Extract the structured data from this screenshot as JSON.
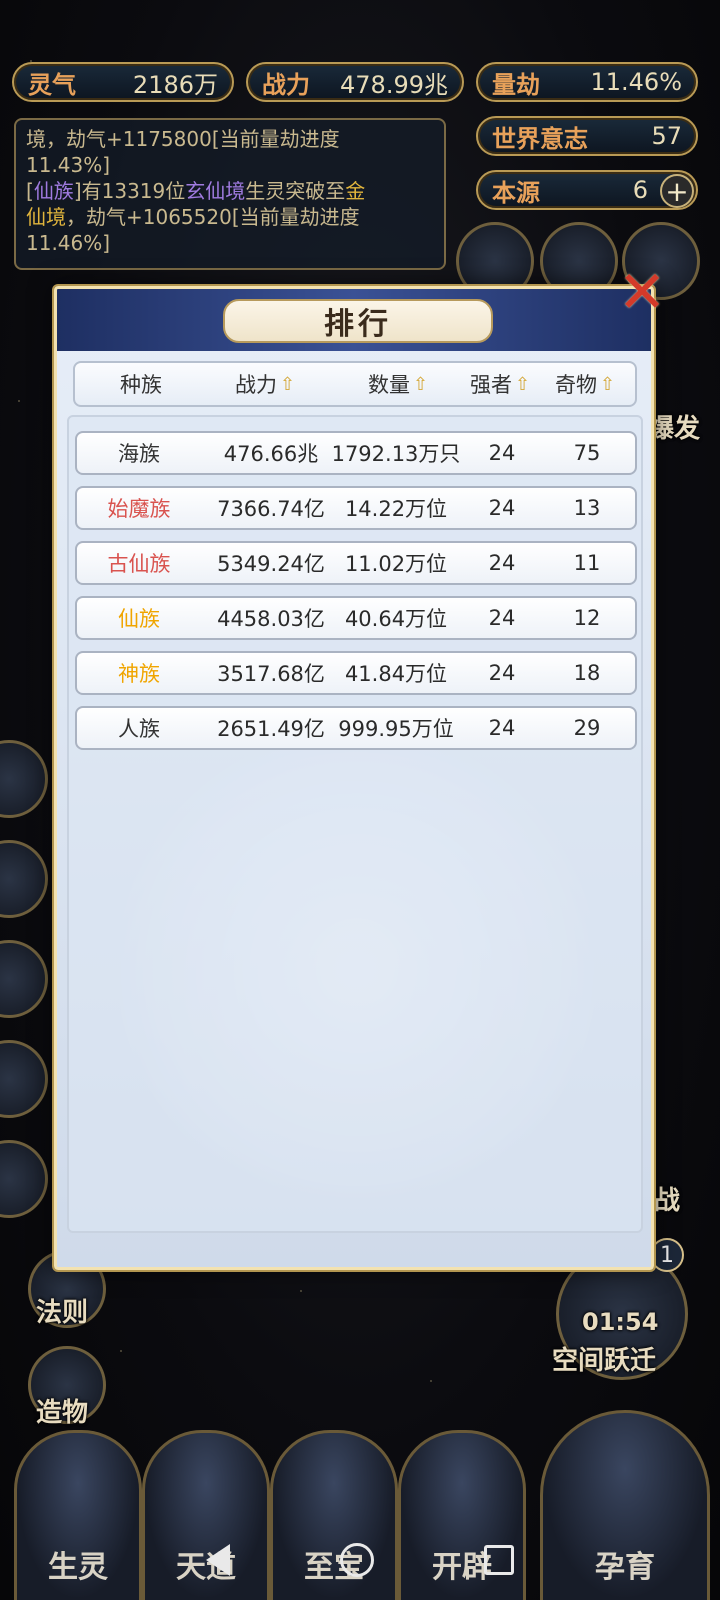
{
  "stats": {
    "lingqi": {
      "label": "灵气",
      "value": "2186万"
    },
    "zhanli": {
      "label": "战力",
      "value": "478.99兆"
    },
    "liangjie": {
      "label": "量劫",
      "value": "11.46%"
    },
    "world_will": {
      "label": "世界意志",
      "value": "57"
    },
    "origin": {
      "label": "本源",
      "value": "6"
    }
  },
  "log": {
    "line1": "境，劫气+1175800[当前量劫进度",
    "line2": "11.43%]",
    "line3_a": "[",
    "line3_race": "仙族",
    "line3_b": "]有13319位",
    "line3_realm": "玄仙境",
    "line3_c": "生灵突破至",
    "line3_target": "金",
    "line4_target": "仙境",
    "line4_rest": "，劫气+1065520[当前量劫进度",
    "line5": "11.46%]"
  },
  "dialog": {
    "title": "排行",
    "close_icon": "close-x",
    "headers": {
      "race": "种族",
      "power": "战力",
      "count": "数量",
      "strong": "强者",
      "treasure": "奇物"
    },
    "sort_icon": "sort-arrow-up",
    "rows": [
      {
        "race": "海族",
        "power": "476.66兆",
        "count": "1792.13万只",
        "strong": "24",
        "treasure": "75",
        "race_color": "#333333"
      },
      {
        "race": "始魔族",
        "power": "7366.74亿",
        "count": "14.22万位",
        "strong": "24",
        "treasure": "13",
        "race_color": "#d9534f"
      },
      {
        "race": "古仙族",
        "power": "5349.24亿",
        "count": "11.02万位",
        "strong": "24",
        "treasure": "11",
        "race_color": "#d9534f"
      },
      {
        "race": "仙族",
        "power": "4458.03亿",
        "count": "40.64万位",
        "strong": "24",
        "treasure": "12",
        "race_color": "#f0a500"
      },
      {
        "race": "神族",
        "power": "3517.68亿",
        "count": "41.84万位",
        "strong": "24",
        "treasure": "18",
        "race_color": "#f0a500"
      },
      {
        "race": "人族",
        "power": "2651.49亿",
        "count": "999.95万位",
        "strong": "24",
        "treasure": "29",
        "race_color": "#333333"
      }
    ]
  },
  "side": {
    "right_partial_1": "爆发",
    "right_partial_2": "战",
    "left_fa": "法则",
    "left_zao": "造物",
    "timer": "01:54",
    "timer_badge": "1",
    "space_jump": "空间跃迁"
  },
  "bottom_tabs": [
    "生灵",
    "天道",
    "至宝",
    "开辟",
    "孕育"
  ]
}
